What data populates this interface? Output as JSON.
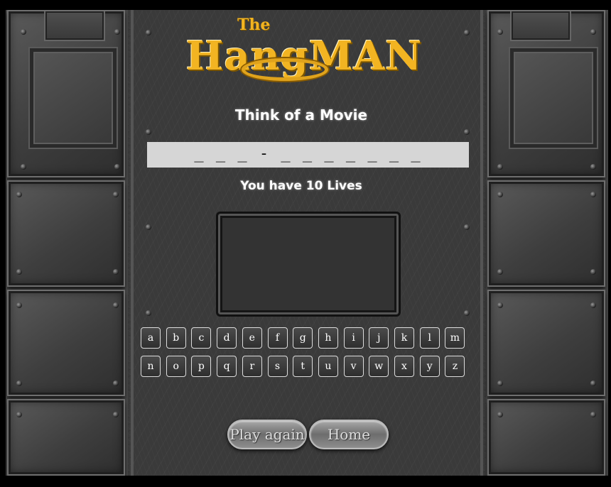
{
  "logo": {
    "the": "The",
    "title": "HangMAN",
    "alt": "The HangMAN"
  },
  "game": {
    "hint": "Think of a Movie",
    "word_pattern": "_ _ _ - _ _ _ _ _ _ _",
    "lives_text": "You have 10 Lives"
  },
  "keyboard": {
    "row1": [
      "a",
      "b",
      "c",
      "d",
      "e",
      "f",
      "g",
      "h",
      "i",
      "j",
      "k",
      "l",
      "m"
    ],
    "row2": [
      "n",
      "o",
      "p",
      "q",
      "r",
      "s",
      "t",
      "u",
      "v",
      "w",
      "x",
      "y",
      "z"
    ]
  },
  "buttons": {
    "play_again": "Play again",
    "home": "Home"
  },
  "colors": {
    "logo_yellow": "#f2b422",
    "word_bar": "#d6d6d6",
    "text_white": "#ffffff"
  }
}
